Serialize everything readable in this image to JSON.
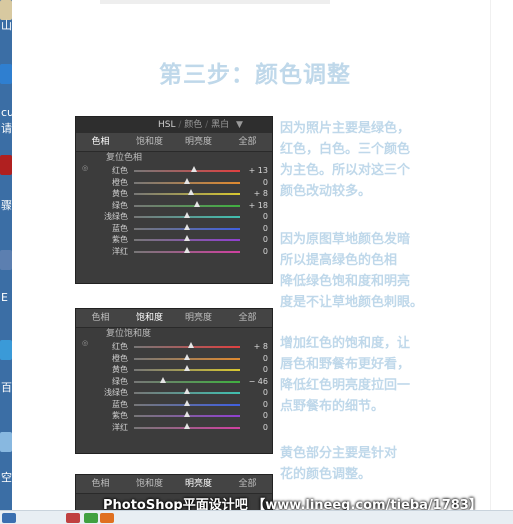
{
  "desktop": {
    "labels": [
      "山",
      "cu",
      "请",
      "骤",
      "E",
      "百",
      "空"
    ]
  },
  "page": {
    "title": "第三步：颜色调整",
    "watermark": "PhotoShop平面设计吧 【www.lineeg.com/tieba/1783】"
  },
  "panel1": {
    "header_hsl": "HSL",
    "header_color": "颜色",
    "header_bw": "黑白",
    "tabs": [
      "色相",
      "饱和度",
      "明亮度",
      "全部"
    ],
    "section_title": "复位色相",
    "rows": [
      {
        "label": "红色",
        "value": "+ 13",
        "level": 0.13,
        "color": "#e04040"
      },
      {
        "label": "橙色",
        "value": "0",
        "level": 0,
        "color": "#e08a30"
      },
      {
        "label": "黄色",
        "value": "+ 8",
        "level": 0.08,
        "color": "#d8c830"
      },
      {
        "label": "绿色",
        "value": "+ 18",
        "level": 0.18,
        "color": "#40b040"
      },
      {
        "label": "浅绿色",
        "value": "0",
        "level": 0,
        "color": "#40c0b0"
      },
      {
        "label": "蓝色",
        "value": "0",
        "level": 0,
        "color": "#4060e0"
      },
      {
        "label": "紫色",
        "value": "0",
        "level": 0,
        "color": "#9040d0"
      },
      {
        "label": "洋红",
        "value": "0",
        "level": 0,
        "color": "#d040a0"
      }
    ]
  },
  "panel2": {
    "tabs": [
      "色相",
      "饱和度",
      "明亮度",
      "全部"
    ],
    "section_title": "复位饱和度",
    "rows": [
      {
        "label": "红色",
        "value": "+ 8",
        "level": 0.08,
        "color": "#e04040"
      },
      {
        "label": "橙色",
        "value": "0",
        "level": 0,
        "color": "#e08a30"
      },
      {
        "label": "黄色",
        "value": "0",
        "level": 0,
        "color": "#d8c830"
      },
      {
        "label": "绿色",
        "value": "− 46",
        "level": -0.46,
        "color": "#40b040"
      },
      {
        "label": "浅绿色",
        "value": "0",
        "level": 0,
        "color": "#40c0b0"
      },
      {
        "label": "蓝色",
        "value": "0",
        "level": 0,
        "color": "#4060e0"
      },
      {
        "label": "紫色",
        "value": "0",
        "level": 0,
        "color": "#9040d0"
      },
      {
        "label": "洋红",
        "value": "0",
        "level": 0,
        "color": "#d040a0"
      }
    ]
  },
  "panel3": {
    "tabs": [
      "色相",
      "饱和度",
      "明亮度",
      "全部"
    ]
  },
  "captions": {
    "c1": [
      "因为照片主要是绿色，",
      "红色，白色。三个颜色",
      "为主色。所以对这三个",
      "颜色改动较多。"
    ],
    "c2": [
      "因为原图草地颜色发暗",
      "所以提高绿色的色相",
      "降低绿色饱和度和明亮",
      "度是不让草地颜色刺眼。"
    ],
    "c3": [
      "增加红色的饱和度，让",
      "唇色和野餐布更好看，",
      "降低红色明亮度拉回一",
      "点野餐布的细节。"
    ],
    "c4": [
      "黄色部分主要是针对",
      "花的颜色调整。"
    ]
  },
  "colors": {
    "title": "#bfd8ea",
    "caption": "#bfd8ea",
    "panel_bg": "#3c3c3c"
  }
}
